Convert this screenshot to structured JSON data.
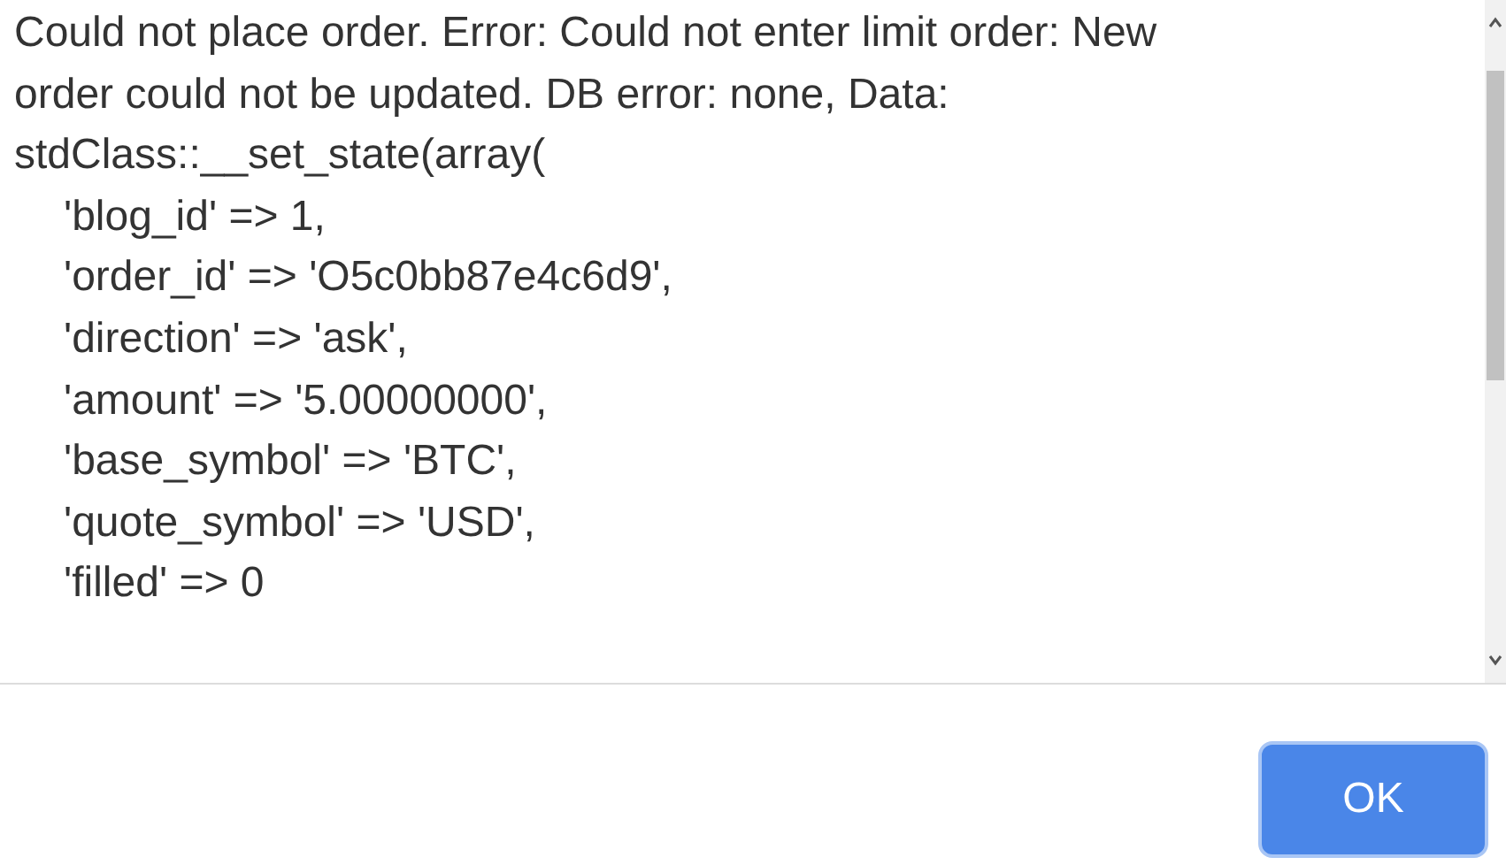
{
  "message": "Could not place order. Error: Could not enter limit order: New order could not be updated. DB error: none, Data:",
  "lines": [
    {
      "kind": "plain",
      "text": "stdClass::__set_state(array("
    },
    {
      "kind": "entry",
      "text": "'blog_id' => 1,"
    },
    {
      "kind": "entry",
      "text": "'order_id' => 'O5c0bb87e4c6d9',"
    },
    {
      "kind": "entry",
      "text": "'direction' => 'ask',"
    },
    {
      "kind": "entry",
      "text": "'amount' => '5.00000000',"
    },
    {
      "kind": "entry",
      "text": "'base_symbol' => 'BTC',"
    },
    {
      "kind": "entry",
      "text": "'quote_symbol' => 'USD',"
    },
    {
      "kind": "entry",
      "text": "'filled' => 0"
    }
  ],
  "button": "OK"
}
